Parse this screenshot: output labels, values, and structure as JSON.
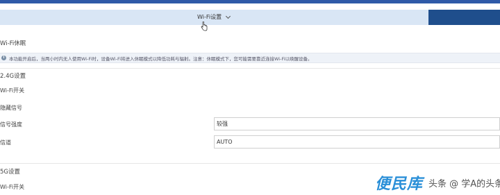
{
  "header": {
    "title": "Wi-Fi设置"
  },
  "wifi_sleep": {
    "section_title": "Wi-Fi休眠",
    "notice_text": "本功能开启后，当两小时内无人使用Wi-Fi时，设备Wi-Fi将进入休眠模式以降低功耗与辐射。注意：休眠模式下，您可能需要靠近连接Wi-Fi以唤醒设备。"
  },
  "band_24g": {
    "section_title": "2.4G设置",
    "wifi_switch_label": "Wi-Fi开关",
    "hidden_ssid_label": "隐藏信号",
    "signal_strength_label": "信号强度",
    "signal_strength_value": "较强",
    "channel_label": "信道",
    "channel_value": "AUTO"
  },
  "band_5g": {
    "section_title": "5G设置",
    "wifi_switch_label": "Wi-Fi开关"
  },
  "watermark": {
    "logo": "便民库",
    "caption": "头条 @ 学A的头条号"
  },
  "colors": {
    "top_strip": "#2f5aa8",
    "header_bar": "#d9e6f5",
    "header_right": "#1f4e8c",
    "watermark_logo": "#2a8fd8"
  }
}
